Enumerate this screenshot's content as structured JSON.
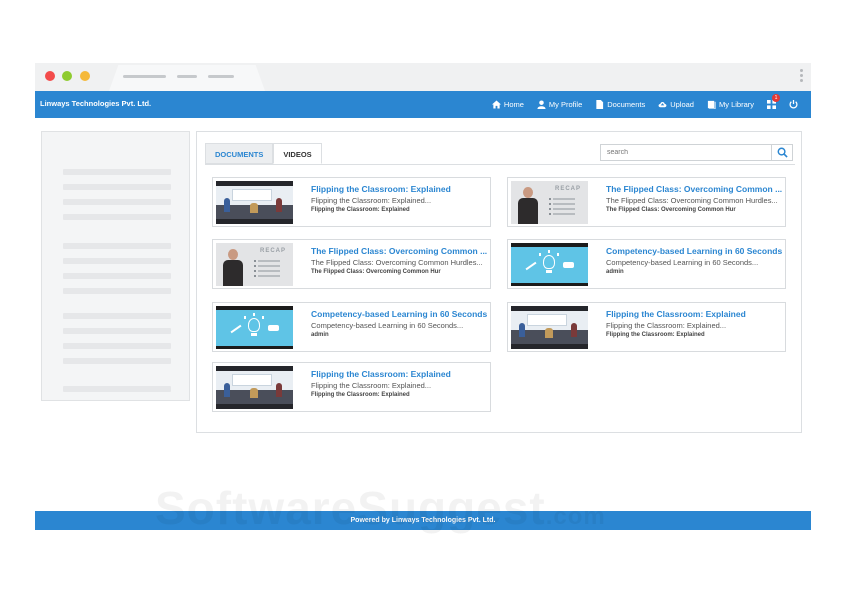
{
  "header": {
    "brand": "Linways Technologies Pvt. Ltd.",
    "nav": [
      {
        "label": "Home",
        "icon": "home-icon"
      },
      {
        "label": "My Profile",
        "icon": "user-icon"
      },
      {
        "label": "Documents",
        "icon": "document-icon"
      },
      {
        "label": "Upload",
        "icon": "upload-icon"
      },
      {
        "label": "My Library",
        "icon": "library-icon"
      }
    ],
    "notification_count": "1",
    "icons": [
      "apps-icon",
      "power-icon"
    ]
  },
  "tabs": [
    "DOCUMENTS",
    "VIDEOS"
  ],
  "search": {
    "placeholder": "search"
  },
  "videos": [
    {
      "title": "Flipping the Classroom: Explained",
      "subtitle": "Flipping the Classroom: Explained...",
      "meta": "Flipping the Classroom: Explained",
      "thumb": "classroom"
    },
    {
      "title": "The Flipped Class: Overcoming Common ...",
      "subtitle": "The Flipped Class: Overcoming Common Hurdles...",
      "meta": "The Flipped Class: Overcoming Common Hur",
      "thumb": "recap"
    },
    {
      "title": "The Flipped Class: Overcoming Common ...",
      "subtitle": "The Flipped Class: Overcoming Common Hurdles...",
      "meta": "The Flipped Class: Overcoming Common Hur",
      "thumb": "recap"
    },
    {
      "title": "Competency-based Learning in 60 Seconds",
      "subtitle": "Competency-based Learning in 60 Seconds...",
      "meta": "admin",
      "thumb": "competency"
    },
    {
      "title": "Competency-based Learning in 60 Seconds",
      "subtitle": "Competency-based Learning in 60 Seconds...",
      "meta": "admin",
      "thumb": "competency"
    },
    {
      "title": "Flipping the Classroom: Explained",
      "subtitle": "Flipping the Classroom: Explained...",
      "meta": "Flipping the Classroom: Explained",
      "thumb": "classroom"
    },
    {
      "title": "Flipping the Classroom: Explained",
      "subtitle": "Flipping the Classroom: Explained...",
      "meta": "Flipping the Classroom: Explained",
      "thumb": "classroom"
    }
  ],
  "footer": {
    "text": "Powered by Linways Technologies Pvt. Ltd."
  },
  "watermark": {
    "main": "SoftwareSuggest",
    "suffix": ".com"
  },
  "colors": {
    "accent": "#2b86d1",
    "badge": "#e53935"
  }
}
